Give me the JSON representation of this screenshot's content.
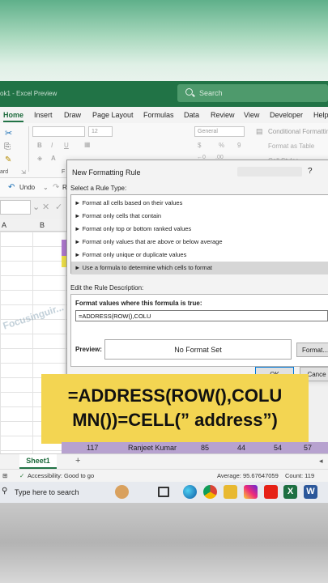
{
  "window": {
    "doc_title": "ok1 - Excel Preview",
    "search_placeholder": "Search"
  },
  "ribbon": {
    "tabs": [
      "Home",
      "Insert",
      "Draw",
      "Page Layout",
      "Formulas",
      "Data",
      "Review",
      "View",
      "Developer",
      "Help"
    ],
    "font_size": "12",
    "number_format": "General",
    "conditional_formatting": "Conditional Formatting",
    "format_as_table": "Format as Table",
    "cell_styles": "Cell Styles",
    "clipboard_label": "ard",
    "undo_label": "Undo",
    "redo_label": "R"
  },
  "grid": {
    "col_a": "A",
    "col_b": "B",
    "watermark": "Focusinguir..."
  },
  "dialog": {
    "title": "New Formatting Rule",
    "help": "?",
    "select_rule_type": "Select a Rule Type:",
    "rule_types": [
      "Format all cells based on their values",
      "Format only cells that contain",
      "Format only top or bottom ranked values",
      "Format only values that are above or below average",
      "Format only unique or duplicate values",
      "Use a formula to determine which cells to format"
    ],
    "edit_description": "Edit the Rule Description:",
    "format_values_label": "Format values where this formula is true:",
    "formula_value": "=ADDRESS(ROW(),COLU",
    "preview_label": "Preview:",
    "preview_text": "No Format Set",
    "format_button": "Format...",
    "ok_button": "OK",
    "cancel_button": "Cance"
  },
  "banner": {
    "line1": "=ADDRESS(ROW(),COLU",
    "line2": "MN())=CELL(” address”)"
  },
  "data_row": {
    "id": "117",
    "name": "Ranjeet Kumar",
    "v1": "85",
    "v2": "44",
    "v3": "54",
    "v4": "57"
  },
  "sheet": {
    "tab_name": "Sheet1",
    "add_sheet": "+"
  },
  "status": {
    "accessibility": "Accessibility: Good to go",
    "average": "Average: 95.67647059",
    "count": "Count: 119"
  },
  "taskbar": {
    "search_placeholder": "Type here to search"
  },
  "colors": {
    "excel_green": "#217346",
    "banner_yellow": "#f3d552",
    "selection": "#d6d6d6"
  }
}
